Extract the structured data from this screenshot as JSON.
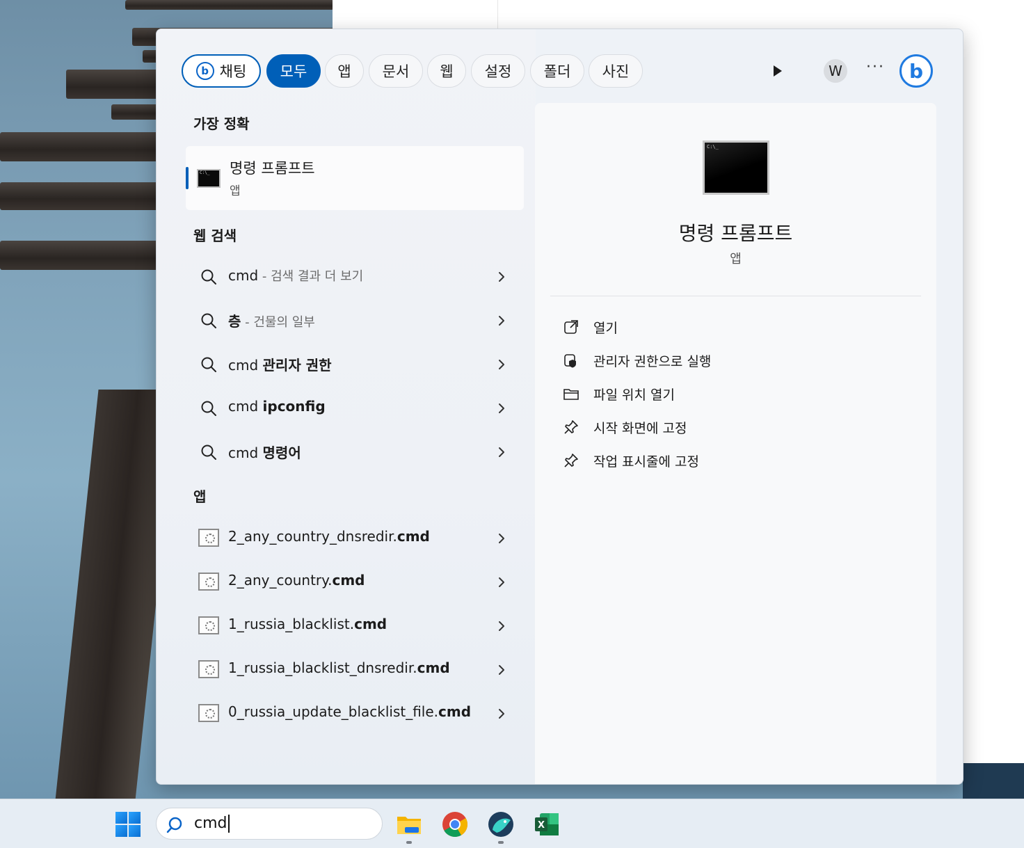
{
  "filters": {
    "chat": "채팅",
    "all": "모두",
    "apps": "앱",
    "docs": "문서",
    "web": "웹",
    "settings": "설정",
    "folders": "폴더",
    "photos": "사진",
    "avatar_letter": "W",
    "more": "···"
  },
  "sections": {
    "best_match": "가장 정확",
    "web_search": "웹 검색",
    "apps": "앱"
  },
  "best_match": {
    "title": "명령 프롬프트",
    "subtitle": "앱"
  },
  "web_results": [
    {
      "prefix": "cmd",
      "bold": "",
      "suffix": " - 검색 결과 더 보기"
    },
    {
      "prefix": "",
      "bold": "층",
      "suffix": " - 건물의 일부"
    },
    {
      "prefix": "cmd ",
      "bold": "관리자 권한",
      "suffix": ""
    },
    {
      "prefix": "cmd ",
      "bold": "ipconfig",
      "suffix": ""
    },
    {
      "prefix": "cmd ",
      "bold": "명령어",
      "suffix": ""
    }
  ],
  "app_results": [
    {
      "prefix": "2_any_country_dnsredir.",
      "bold": "cmd"
    },
    {
      "prefix": "2_any_country.",
      "bold": "cmd"
    },
    {
      "prefix": "1_russia_blacklist.",
      "bold": "cmd"
    },
    {
      "prefix": "1_russia_blacklist_dnsredir.",
      "bold": "cmd"
    },
    {
      "prefix": "0_russia_update_blacklist_file.",
      "bold": "cmd"
    }
  ],
  "detail": {
    "title": "명령 프롬프트",
    "subtitle": "앱",
    "actions": [
      {
        "label": "열기",
        "icon": "open-external-icon"
      },
      {
        "label": "관리자 권한으로 실행",
        "icon": "shield-icon"
      },
      {
        "label": "파일 위치 열기",
        "icon": "folder-icon"
      },
      {
        "label": "시작 화면에 고정",
        "icon": "pin-icon"
      },
      {
        "label": "작업 표시줄에 고정",
        "icon": "pin-icon"
      }
    ]
  },
  "taskbar": {
    "search_value": "cmd",
    "apps": [
      "file-explorer-icon",
      "chrome-icon",
      "browser-icon",
      "excel-icon"
    ]
  },
  "colors": {
    "accent": "#005fb8",
    "bing": "#1f7ae0"
  }
}
